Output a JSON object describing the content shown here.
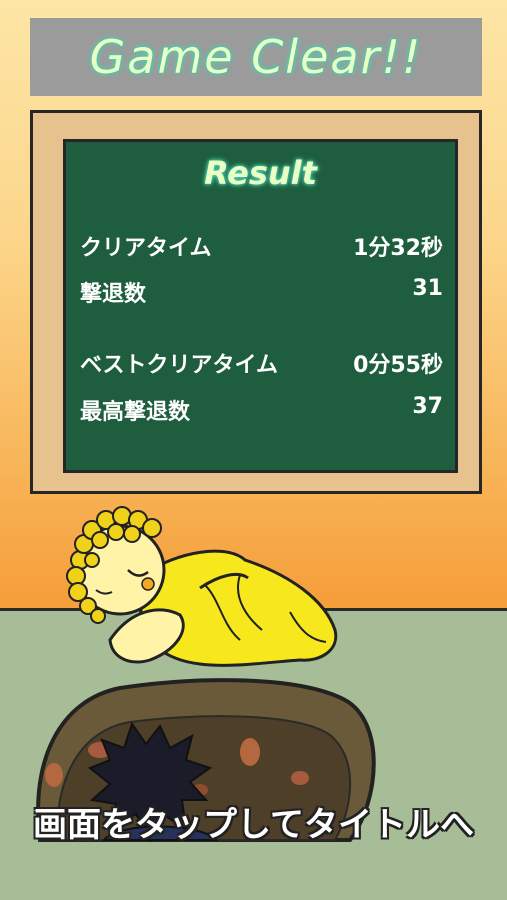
{
  "screen": {
    "title": "Game Clear!!",
    "result": {
      "heading": "Result",
      "rows": [
        {
          "label": "クリアタイム",
          "value": "1分32秒"
        },
        {
          "label": "撃退数",
          "value": "31"
        },
        {
          "label": "ベストクリアタイム",
          "value": "0分55秒"
        },
        {
          "label": "最高撃退数",
          "value": "37"
        }
      ]
    },
    "tap_hint": "画面をタップしてタイトルへ"
  },
  "colors": {
    "wall_top": "#fde6a6",
    "wall_bottom": "#f59d39",
    "floor": "#a6bd98",
    "banner": "#9b9b9b",
    "board": "#1e5d3d",
    "board_frame": "#e7c28f",
    "title_glow": "#4fd8b8"
  },
  "icons": [
    "sleeping-character",
    "curly-hair",
    "pit-hole",
    "spiky-hair-enemy"
  ]
}
